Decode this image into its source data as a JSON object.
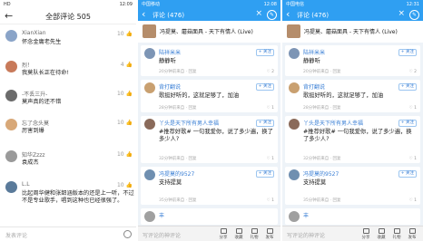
{
  "p1": {
    "status": {
      "left": "HD",
      "right": "12:09"
    },
    "back": "←",
    "title": "全部评论 505",
    "comments": [
      {
        "name": "XianXian",
        "text": "怀念金庸老先生",
        "likes": "10"
      },
      {
        "name": "烈！",
        "text": "我莫队长正在待命!",
        "likes": "4"
      },
      {
        "name": "-不丢三升-",
        "text": "莫声真的还不错",
        "likes": "10"
      },
      {
        "name": "忘了念头莫",
        "text": "厉害到爆",
        "likes": "10"
      },
      {
        "name": "知华Zzzz",
        "text": "袁成杰",
        "likes": "10"
      },
      {
        "name": "L.L",
        "text": "比起周华健和张韶涵版本的还是上一听，不过不是专业歌手，唱到这种也已经很强了。",
        "likes": "10"
      }
    ],
    "input_placeholder": "发表评论"
  },
  "p2": {
    "status": {
      "left": "中国移动",
      "right": "12:08"
    },
    "back": "‹",
    "title": "评论 (476)",
    "song": "冯提莫、蘑菇面具 - 天下有情人 (Live)",
    "follow": "+ 关注",
    "cards": [
      {
        "user": "陆祥米米",
        "text": "静静听",
        "meta": "20分钟前来自 · 回复",
        "actions": "♡ 2"
      },
      {
        "user": "背打翻说",
        "text": "歌挺好听的，这就足够了，加油",
        "meta": "28分钟前来自 · 回复",
        "actions": "♡ 1"
      },
      {
        "user": "丫头是天下所有男人幸福",
        "text": "#推荐好歌# 一句我爱你，说了多少遍，换了多少人?",
        "meta": "32分钟前来自 · 回复",
        "actions": "♡ 1"
      },
      {
        "user": "冯提莫的9527",
        "text": "支持提莫",
        "meta": "35分钟前来自 · 回复",
        "actions": "♡ 1"
      },
      {
        "user": "丰",
        "text": "",
        "meta": "",
        "actions": ""
      }
    ],
    "input_placeholder": "写评论的神评论",
    "foot_icons": [
      "分享",
      "收藏",
      "礼物",
      "发布"
    ]
  },
  "p3": {
    "status": {
      "left": "中国电信",
      "right": "12:31"
    },
    "back": "‹",
    "title": "评论 (476)",
    "song": "冯提莫、蘑菇面具 - 天下有情人 (Live)",
    "follow": "+ 关注",
    "cards": [
      {
        "user": "陆祥米米",
        "text": "静静听",
        "meta": "20分钟前来自 · 回复",
        "actions": "♡ 2"
      },
      {
        "user": "背打翻说",
        "text": "歌挺好听的，这就足够了，加油",
        "meta": "28分钟前来自 · 回复",
        "actions": "♡ 1"
      },
      {
        "user": "丫头是天下所有男人幸福",
        "text": "#推荐好歌# 一句我爱你，说了多少遍，换了多少人?",
        "meta": "32分钟前来自 · 回复",
        "actions": "♡ 1"
      },
      {
        "user": "冯提莫的9527",
        "text": "支持提莫",
        "meta": "35分钟前来自 · 回复",
        "actions": "♡ 1"
      },
      {
        "user": "丰",
        "text": "",
        "meta": "",
        "actions": ""
      }
    ],
    "input_placeholder": "写评论的神评论",
    "foot_icons": [
      "分享",
      "收藏",
      "礼物",
      "发布"
    ]
  },
  "colors": {
    "accent": "#2f9ff2",
    "link": "#3a7fd5"
  }
}
